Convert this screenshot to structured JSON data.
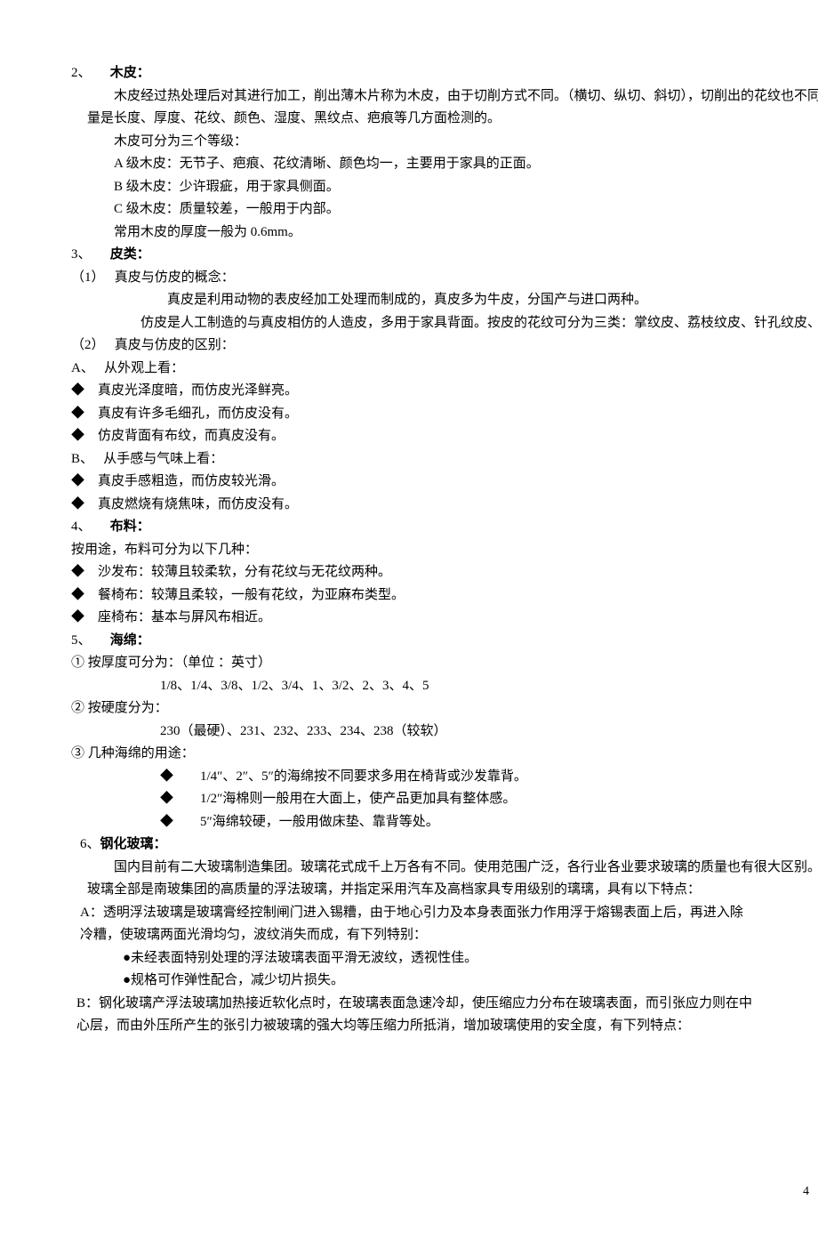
{
  "s2": {
    "num": "2、",
    "title": "木皮：",
    "p1": "木皮经过热处理后对其进行加工，削出薄木片称为木皮，由于切削方式不同。（横切、纵切、斜切），切削出的花纹也不同。木皮的质量是长度、厚度、花纹、颜色、湿度、黑纹点、疤痕等几方面检测的。",
    "p2": "木皮可分为三个等级：",
    "p3": "A 级木皮：无节子、疤痕、花纹清晰、颜色均一，主要用于家具的正面。",
    "p4": "B 级木皮：少许瑕疵，用于家具侧面。",
    "p5": "C 级木皮：质量较差，一般用于内部。",
    "p6": "常用木皮的厚度一般为 0.6mm。"
  },
  "s3": {
    "num": "3、",
    "title": "皮类：",
    "sub1_num": "（1）",
    "sub1_title": "真皮与仿皮的概念：",
    "sub1_p1": "真皮是利用动物的表皮经加工处理而制成的，真皮多为牛皮，分国产与进口两种。",
    "sub1_p2": "仿皮是人工制造的与真皮相仿的人造皮，多用于家具背面。按皮的花纹可分为三类：掌纹皮、荔枝纹皮、针孔纹皮、混合型皮。",
    "sub2_num": "（2）",
    "sub2_title": "真皮与仿皮的区别：",
    "a_num": "A、",
    "a_title": "从外观上看：",
    "a_b1": "◆　真皮光泽度暗，而仿皮光泽鲜亮。",
    "a_b2": "◆　真皮有许多毛细孔，而仿皮没有。",
    "a_b3": "◆　仿皮背面有布纹，而真皮没有。",
    "b_num": "B、",
    "b_title": "从手感与气味上看：",
    "b_b1": "◆　真皮手感粗造，而仿皮较光滑。",
    "b_b2": "◆　真皮燃烧有烧焦味，而仿皮没有。"
  },
  "s4": {
    "num": "4、",
    "title": "布料：",
    "p1": "按用途，布料可分为以下几种：",
    "b1": "◆　沙发布：较薄且较柔软，分有花纹与无花纹两种。",
    "b2": "◆　餐椅布：较薄且柔较，一般有花纹，为亚麻布类型。",
    "b3": "◆　座椅布：基本与屏风布相近。"
  },
  "s5": {
    "num": "5、",
    "title": "海绵：",
    "c1_num": "①",
    "c1_title": "按厚度可分为：（单位 ：英寸）",
    "c1_p": "1/8、1/4、3/8、1/2、3/4、1、3/2、2、3、4、5",
    "c2_num": "②",
    "c2_title": "按硬度分为：",
    "c2_p": "230（最硬）、231、232、233、234、238（较软）",
    "c3_num": "③",
    "c3_title": "几种海绵的用途：",
    "c3_b1": "◆　　1/4″、2″、5″的海绵按不同要求多用在椅背或沙发靠背。",
    "c3_b2": "◆　　1/2″海棉则一般用在大面上，使产品更加具有整体感。",
    "c3_b3": "◆　　5″海绵较硬，一般用做床垫、靠背等处。"
  },
  "s6": {
    "num": "6、",
    "title": "钢化玻璃：",
    "p1": "国内目前有二大玻璃制造集团。玻璃花式成千上万各有不同。使用范围广泛，各行业各业要求玻璃的质量也有很大区别。我司采用的玻璃全部是南玻集团的高质量的浮法玻璃，并指定采用汽车及高档家具专用级别的璃璃，具有以下特点：",
    "a_num": "A：",
    "a_p": "透明浮法玻璃是玻璃膏经控制闸门进入锡糟，由于地心引力及本身表面张力作用浮于熔锡表面上后，再进入除冷糟，使玻璃两面光滑均匀，波纹消失而成，有下列特别：",
    "a_b1": "●未经表面特别处理的浮法玻璃表面平滑无波纹，透视性佳。",
    "a_b2": "●规格可作弹性配合，减少切片损失。",
    "b_num": "B：",
    "b_p": "钢化玻璃产浮法玻璃加热接近软化点时，在玻璃表面急速冷却，使压缩应力分布在玻璃表面，而引张应力则在中心层，而由外压所产生的张引力被玻璃的强大均等压缩力所抵消，增加玻璃使用的安全度，有下列特点："
  },
  "page": "4"
}
